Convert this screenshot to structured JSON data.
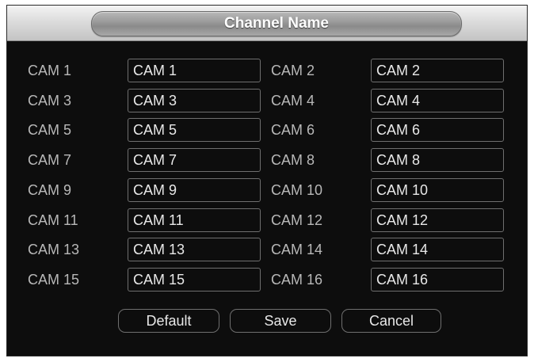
{
  "dialog": {
    "title": "Channel Name"
  },
  "channels": [
    {
      "label": "CAM 1",
      "value": "CAM 1"
    },
    {
      "label": "CAM 2",
      "value": "CAM 2"
    },
    {
      "label": "CAM 3",
      "value": "CAM 3"
    },
    {
      "label": "CAM 4",
      "value": "CAM 4"
    },
    {
      "label": "CAM 5",
      "value": "CAM 5"
    },
    {
      "label": "CAM 6",
      "value": "CAM 6"
    },
    {
      "label": "CAM 7",
      "value": "CAM 7"
    },
    {
      "label": "CAM 8",
      "value": "CAM 8"
    },
    {
      "label": "CAM 9",
      "value": "CAM 9"
    },
    {
      "label": "CAM 10",
      "value": "CAM 10"
    },
    {
      "label": "CAM 11",
      "value": "CAM 11"
    },
    {
      "label": "CAM 12",
      "value": "CAM 12"
    },
    {
      "label": "CAM 13",
      "value": "CAM 13"
    },
    {
      "label": "CAM 14",
      "value": "CAM 14"
    },
    {
      "label": "CAM 15",
      "value": "CAM 15"
    },
    {
      "label": "CAM 16",
      "value": "CAM 16"
    }
  ],
  "buttons": {
    "default_label": "Default",
    "save_label": "Save",
    "cancel_label": "Cancel"
  },
  "colors": {
    "background": "#0d0d0d",
    "label_text": "#b8b8b8",
    "input_text": "#e8e8e8",
    "border": "#6f6f6f"
  }
}
